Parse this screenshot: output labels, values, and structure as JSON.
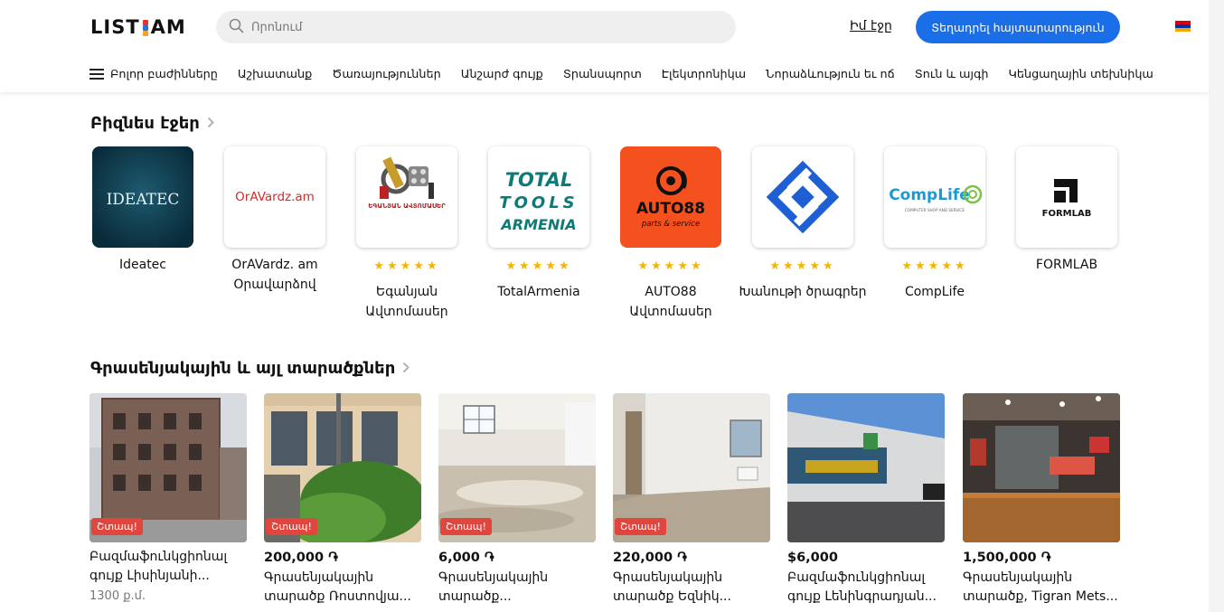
{
  "header": {
    "logo_text_left": "LIST",
    "logo_text_right": "AM",
    "search_placeholder": "Որոնում",
    "my_page": "Իմ էջը",
    "post_button": "Տեղադրել հայտարարություն",
    "language_flag": "armenia-flag",
    "flag_colors": [
      "#d90012",
      "#0033a0",
      "#f2a800"
    ]
  },
  "nav": {
    "all_categories": "Բոլոր բաժինները",
    "items": [
      "Աշխատանք",
      "Ծառայություններ",
      "Անշարժ գույք",
      "Տրանսպորտ",
      "Էլեկտրոնիկա",
      "Նորաձևություն եւ ոճ",
      "Տուն և այգի",
      "Կենցաղային տեխնիկա"
    ]
  },
  "business": {
    "title": "Բիզնես էջեր",
    "items": [
      {
        "name": "Ideatec",
        "logo_text": "IDEATEC",
        "stars": ""
      },
      {
        "name": "OrAVardz. am Օրավարձով",
        "logo_text": "OrAVardz.am",
        "stars": ""
      },
      {
        "name": "Եգանյան Ավտոմասեր",
        "logo_text": "ԵԳԱՆՅԱՆ ԱՎՏՈՄԱՍԵՐ",
        "stars": "★★★★★"
      },
      {
        "name": "TotalArmenia",
        "logo_text": "TOTAL TOOLS ARMENIA",
        "stars": "★★★★★"
      },
      {
        "name": "AUTO88 Ավտոմասեր",
        "logo_text": "AUTO88 parts & service",
        "stars": "★★★★★"
      },
      {
        "name": "Խանութի ծրագրեր",
        "logo_text": "",
        "stars": "★★★★★"
      },
      {
        "name": "CompLife",
        "logo_text": "CompLife",
        "logo_sub": "COMPUTER SHOP AND SERVICE",
        "stars": "★★★★★"
      },
      {
        "name": "FORMLAB",
        "logo_text": "FORMLAB",
        "stars": ""
      }
    ]
  },
  "listings": {
    "title": "Գրասենյակային և այլ տարածքներ",
    "urgent_label": "Շտապ!",
    "items": [
      {
        "price": "",
        "title": "Բազմաֆունկցիոնալ գույք Լիսինյանի...",
        "meta": "1300 ք.մ.",
        "urgent": true
      },
      {
        "price": "200,000 ֏",
        "title": "Գրասենյակային տարածք Ռոստովյա...",
        "meta": "",
        "urgent": true
      },
      {
        "price": "6,000 ֏",
        "title": "Գրասենյակային տարածք...",
        "meta": "",
        "urgent": true
      },
      {
        "price": "220,000 ֏",
        "title": "Գրասենյակային տարածք Եզնիկ...",
        "meta": "",
        "urgent": true
      },
      {
        "price": "$6,000",
        "title": "Բազմաֆունկցիոնալ գույք Լենինգրադյան...",
        "meta": "",
        "urgent": false
      },
      {
        "price": "1,500,000 ֏",
        "title": "Գրասենյակային տարածք, Tigran Mets...",
        "meta": "",
        "urgent": false
      }
    ]
  }
}
